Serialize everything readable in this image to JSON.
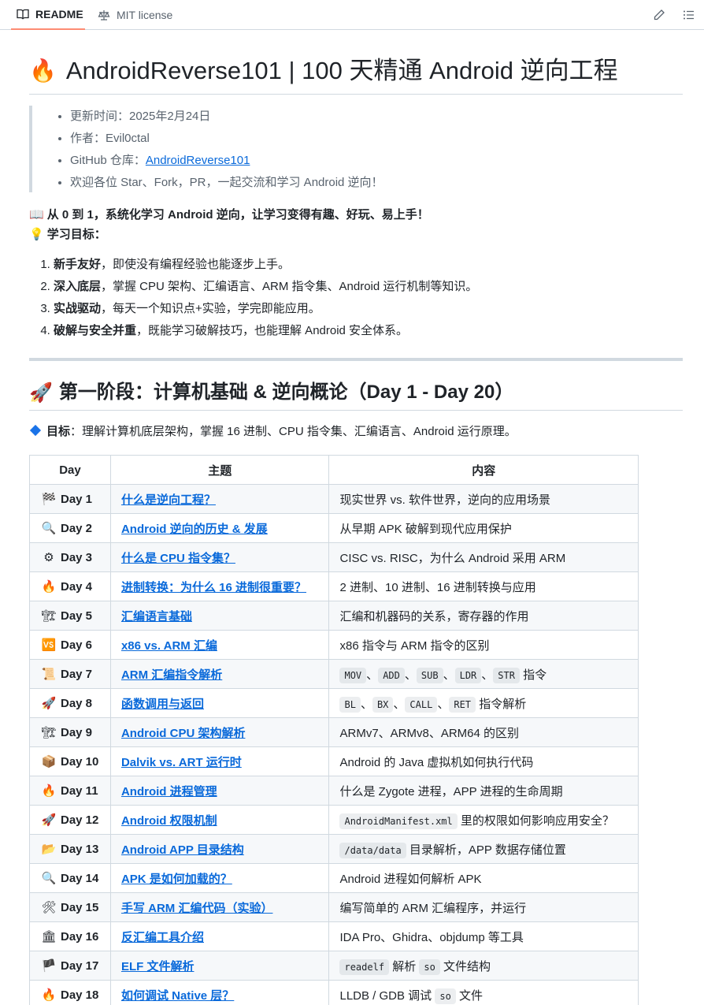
{
  "tabs": {
    "readme": "README",
    "license": "MIT license"
  },
  "title": {
    "emoji": "🔥",
    "text": "AndroidReverse101 | 100 天精通 Android 逆向工程"
  },
  "info": {
    "updated": "更新时间：2025年2月24日",
    "author": "作者：Evil0ctal",
    "repo_label": "GitHub 仓库：",
    "repo_link": "AndroidReverse101",
    "welcome": "欢迎各位 Star、Fork，PR，一起交流和学习 Android 逆向！"
  },
  "intro": {
    "line1_emoji": "📖",
    "line1": "从 0 到 1，系统化学习 Android 逆向，让学习变得有趣、好玩、易上手！",
    "line2_emoji": "💡",
    "line2": "学习目标："
  },
  "goals": [
    {
      "bold": "新手友好",
      "text": "，即使没有编程经验也能逐步上手。"
    },
    {
      "bold": "深入底层",
      "text": "，掌握 CPU 架构、汇编语言、ARM 指令集、Android 运行机制等知识。"
    },
    {
      "bold": "实战驱动",
      "text": "，每天一个知识点+实验，学完即能应用。"
    },
    {
      "bold": "破解与安全并重",
      "text": "，既能学习破解技巧，也能理解 Android 安全体系。"
    }
  ],
  "stage1": {
    "emoji": "🚀",
    "heading": "第一阶段：计算机基础 & 逆向概论（Day 1 - Day 20）",
    "target_bold": "目标",
    "target_text": "：理解计算机底层架构，掌握 16 进制、CPU 指令集、汇编语言、Android 运行原理。",
    "headers": {
      "day": "Day",
      "topic": "主题",
      "content": "内容"
    },
    "rows": [
      {
        "emoji": "🏁",
        "day": "Day 1",
        "topic": "什么是逆向工程？",
        "parts": [
          {
            "t": "现实世界 vs. 软件世界，逆向的应用场景"
          }
        ]
      },
      {
        "emoji": "🔍",
        "day": "Day 2",
        "topic": "Android 逆向的历史 & 发展",
        "parts": [
          {
            "t": "从早期 APK 破解到现代应用保护"
          }
        ]
      },
      {
        "emoji": "⚙",
        "day": "Day 3",
        "topic": "什么是 CPU 指令集？",
        "parts": [
          {
            "t": "CISC vs. RISC，为什么 Android 采用 ARM"
          }
        ]
      },
      {
        "emoji": "🔥",
        "day": "Day 4",
        "topic": "进制转换：为什么 16 进制很重要？",
        "parts": [
          {
            "t": "2 进制、10 进制、16 进制转换与应用"
          }
        ]
      },
      {
        "emoji": "🏗",
        "day": "Day 5",
        "topic": "汇编语言基础",
        "parts": [
          {
            "t": "汇编和机器码的关系，寄存器的作用"
          }
        ]
      },
      {
        "emoji": "🆚",
        "day": "Day 6",
        "topic": "x86 vs. ARM 汇编",
        "parts": [
          {
            "t": "x86 指令与 ARM 指令的区别"
          }
        ]
      },
      {
        "emoji": "📜",
        "day": "Day 7",
        "topic": "ARM 汇编指令解析",
        "parts": [
          {
            "c": "MOV"
          },
          {
            "t": "、"
          },
          {
            "c": "ADD"
          },
          {
            "t": "、"
          },
          {
            "c": "SUB"
          },
          {
            "t": "、"
          },
          {
            "c": "LDR"
          },
          {
            "t": "、"
          },
          {
            "c": "STR"
          },
          {
            "t": " 指令"
          }
        ]
      },
      {
        "emoji": "🚀",
        "day": "Day 8",
        "topic": "函数调用与返回",
        "parts": [
          {
            "c": "BL"
          },
          {
            "t": "、"
          },
          {
            "c": "BX"
          },
          {
            "t": "、"
          },
          {
            "c": "CALL"
          },
          {
            "t": "、"
          },
          {
            "c": "RET"
          },
          {
            "t": " 指令解析"
          }
        ]
      },
      {
        "emoji": "🏗",
        "day": "Day 9",
        "topic": "Android CPU 架构解析",
        "parts": [
          {
            "t": "ARMv7、ARMv8、ARM64 的区别"
          }
        ]
      },
      {
        "emoji": "📦",
        "day": "Day 10",
        "topic": "Dalvik vs. ART 运行时",
        "parts": [
          {
            "t": "Android 的 Java 虚拟机如何执行代码"
          }
        ]
      },
      {
        "emoji": "🔥",
        "day": "Day 11",
        "topic": "Android 进程管理",
        "parts": [
          {
            "t": "什么是 Zygote 进程，APP 进程的生命周期"
          }
        ]
      },
      {
        "emoji": "🚀",
        "day": "Day 12",
        "topic": "Android 权限机制",
        "parts": [
          {
            "c": "AndroidManifest.xml"
          },
          {
            "t": " 里的权限如何影响应用安全？"
          }
        ]
      },
      {
        "emoji": "📂",
        "day": "Day 13",
        "topic": "Android APP 目录结构",
        "parts": [
          {
            "c": "/data/data"
          },
          {
            "t": " 目录解析，APP 数据存储位置"
          }
        ]
      },
      {
        "emoji": "🔍",
        "day": "Day 14",
        "topic": "APK 是如何加载的？",
        "parts": [
          {
            "t": "Android 进程如何解析 APK"
          }
        ]
      },
      {
        "emoji": "🛠",
        "day": "Day 15",
        "topic": "手写 ARM 汇编代码（实验）",
        "parts": [
          {
            "t": "编写简单的 ARM 汇编程序，并运行"
          }
        ]
      },
      {
        "emoji": "🏛",
        "day": "Day 16",
        "topic": "反汇编工具介绍",
        "parts": [
          {
            "t": "IDA Pro、Ghidra、objdump 等工具"
          }
        ]
      },
      {
        "emoji": "🏴",
        "day": "Day 17",
        "topic": "ELF 文件解析",
        "parts": [
          {
            "c": "readelf"
          },
          {
            "t": " 解析 "
          },
          {
            "c": "so"
          },
          {
            "t": " 文件结构"
          }
        ]
      },
      {
        "emoji": "🔥",
        "day": "Day 18",
        "topic": "如何调试 Native 层？",
        "parts": [
          {
            "t": "LLDB / GDB 调试 "
          },
          {
            "c": "so"
          },
          {
            "t": " 文件"
          }
        ]
      }
    ]
  },
  "colors": {
    "link": "#0969da",
    "border": "#d1d9e0",
    "stripe": "#f6f8fa",
    "tab_underline": "#fd8c73"
  },
  "icons": [
    "book-icon",
    "law-icon",
    "pencil-icon",
    "list-icon"
  ]
}
